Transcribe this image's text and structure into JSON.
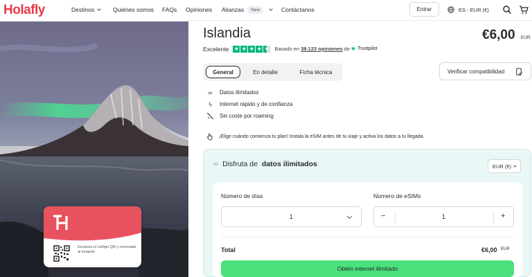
{
  "nav": {
    "logo": "Holafly",
    "destinos": "Destinos",
    "quienes": "Quiénes somos",
    "faqs": "FAQs",
    "opiniones": "Opiniones",
    "alianzas": "Alianzas",
    "new_badge": "New",
    "contactanos": "Contáctanos",
    "entrar": "Entrar",
    "lang": "ES - EUR (€)",
    "icons": [
      "globe-icon",
      "search-icon",
      "cart-icon"
    ]
  },
  "hero": {
    "qr_text": "Escanea el código QR y conéctate al instante",
    "icons": [
      "holafly-h-logo"
    ]
  },
  "product": {
    "title": "Islandia",
    "price": "€6,00",
    "price_currency": "EUR",
    "rating_word": "Excelente",
    "based_on": "Basado en",
    "reviews": "39.123 opiniones",
    "de": "de",
    "trustpilot": "Trustpilot",
    "stars": 4.5,
    "tabs": [
      "General",
      "En detalle",
      "Ficha técnica"
    ],
    "verify": "Verificar compatibilidad",
    "features": [
      "Datos ilimitados",
      "Internet rápido y de confianza",
      "Sin coste por roaming"
    ],
    "notice": "¡Elige cuándo comienza tu plan! Instala la eSIM antes de tu viaje y activa los datos a tu llegada."
  },
  "plan": {
    "title_prefix": "Disfruta de",
    "title_bold": "datos ilimitados",
    "currency": "EUR (€)",
    "days_label": "Número de días",
    "days_value": "1",
    "esims_label": "Número de eSIMs",
    "esims_value": "1",
    "minus": "−",
    "plus": "+",
    "total_label": "Total",
    "total_value": "€6,00",
    "total_currency": "EUR",
    "cta": "Obtén internet ilimitado"
  },
  "colors": {
    "brand": "#e63946",
    "cta": "#4be07b",
    "trustpilot": "#00b67a",
    "panel": "#e9f7f7"
  }
}
